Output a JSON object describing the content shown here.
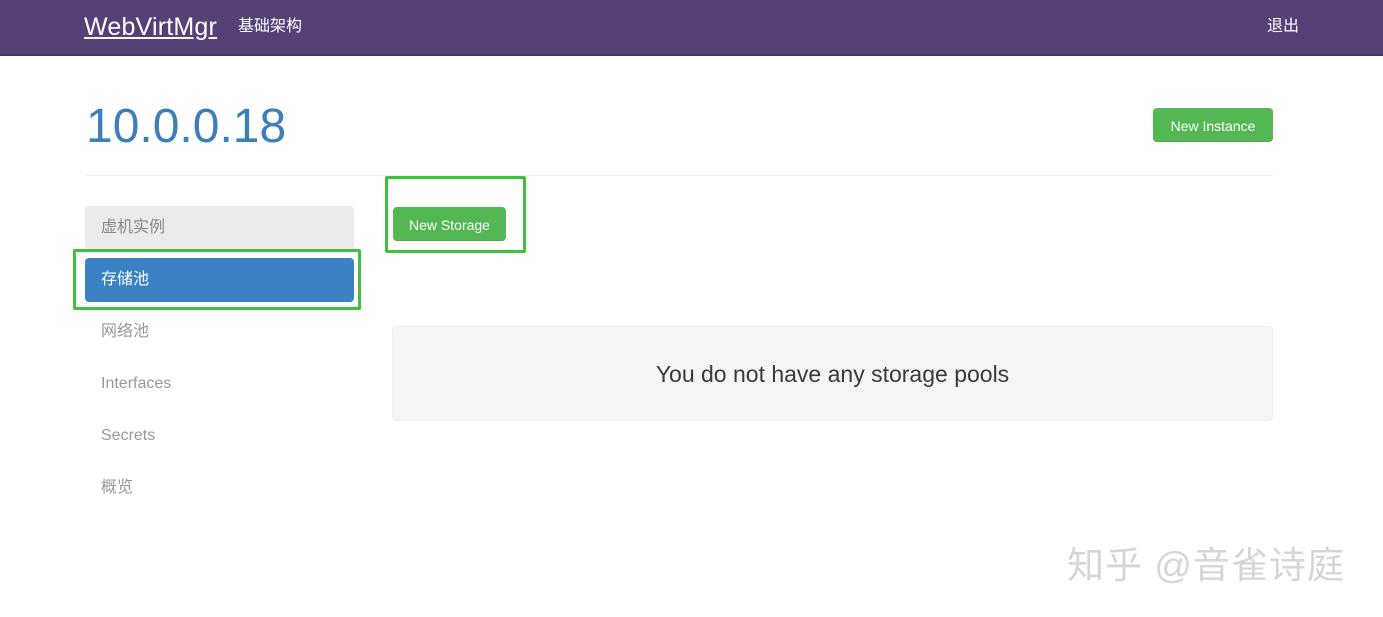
{
  "navbar": {
    "brand": "WebVirtMgr",
    "links": [
      {
        "label": "基础架构",
        "name": "nav-infrastructure"
      }
    ],
    "right_link": {
      "label": "退出",
      "name": "nav-logout"
    },
    "background_color": "#554077"
  },
  "header": {
    "title": "10.0.0.18",
    "title_color": "#3d7fb8",
    "new_instance_button": "New Instance",
    "button_color": "#53b753"
  },
  "sidebar": {
    "items": [
      {
        "label": "虚机实例",
        "state": "hovered"
      },
      {
        "label": "存储池",
        "state": "active"
      },
      {
        "label": "网络池",
        "state": "default"
      },
      {
        "label": "Interfaces",
        "state": "default"
      },
      {
        "label": "Secrets",
        "state": "default"
      },
      {
        "label": "概览",
        "state": "default"
      }
    ],
    "active_color": "#3a82c4",
    "hover_color": "#ebebeb"
  },
  "main": {
    "new_storage_button": "New Storage",
    "empty_message": "You do not have any storage pools"
  },
  "annotations": {
    "color": "#3fc03f",
    "boxes": [
      {
        "target": "new-storage-button"
      },
      {
        "target": "sidebar-item-storage-pools"
      }
    ]
  },
  "watermark": {
    "text": "知乎 @音雀诗庭"
  }
}
